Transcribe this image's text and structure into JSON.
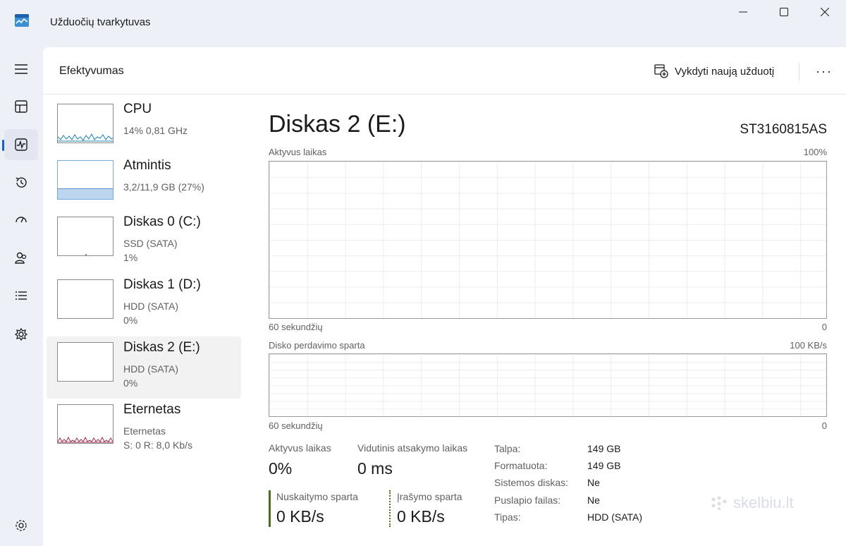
{
  "window": {
    "title": "Užduočių tvarkytuvas"
  },
  "header": {
    "title": "Efektyvumas",
    "run_task_label": "Vykdyti naują užduotį",
    "more_label": "···"
  },
  "devices": [
    {
      "name": "CPU",
      "line1": "14% 0,81 GHz",
      "line2": "",
      "utilization_percent": 14
    },
    {
      "name": "Atmintis",
      "line1": "3,2/11,9 GB (27%)",
      "line2": "",
      "utilization_percent": 27
    },
    {
      "name": "Diskas 0 (C:)",
      "line1": "SSD (SATA)",
      "line2": "1%",
      "utilization_percent": 1
    },
    {
      "name": "Diskas 1 (D:)",
      "line1": "HDD (SATA)",
      "line2": "0%",
      "utilization_percent": 0
    },
    {
      "name": "Diskas 2 (E:)",
      "line1": "HDD (SATA)",
      "line2": "0%",
      "utilization_percent": 0
    },
    {
      "name": "Eternetas",
      "line1": "Eternetas",
      "line2": "S: 0 R: 8,0 Kb/s",
      "utilization_percent": 0
    }
  ],
  "detail": {
    "title": "Diskas 2 (E:)",
    "model": "ST3160815AS",
    "graph1": {
      "label": "Aktyvus laikas",
      "max": "100%",
      "time_label": "60 sekundžių",
      "min": "0"
    },
    "graph2": {
      "label": "Disko perdavimo sparta",
      "max": "100 KB/s",
      "time_label": "60 sekundžių",
      "min": "0"
    },
    "stats": {
      "active_time_label": "Aktyvus laikas",
      "active_time_value": "0%",
      "response_label": "Vidutinis atsakymo laikas",
      "response_value": "0 ms",
      "read_label": "Nuskaitymo sparta",
      "read_value": "0 KB/s",
      "write_label": "Įrašymo sparta",
      "write_value": "0 KB/s"
    },
    "properties": [
      {
        "key": "Talpa:",
        "value": "149 GB"
      },
      {
        "key": "Formatuota:",
        "value": "149 GB"
      },
      {
        "key": "Sistemos diskas:",
        "value": "Ne"
      },
      {
        "key": "Puslapio failas:",
        "value": "Ne"
      },
      {
        "key": "Tipas:",
        "value": "HDD (SATA)"
      }
    ]
  },
  "watermark": "skelbiu.lt",
  "colors": {
    "accent": "#0f63c9",
    "cpu_line": "#1a7fb0",
    "memory_fill": "#bcd6f0",
    "disk_line": "#4c6d1f",
    "ethernet_line": "#a0274f"
  }
}
